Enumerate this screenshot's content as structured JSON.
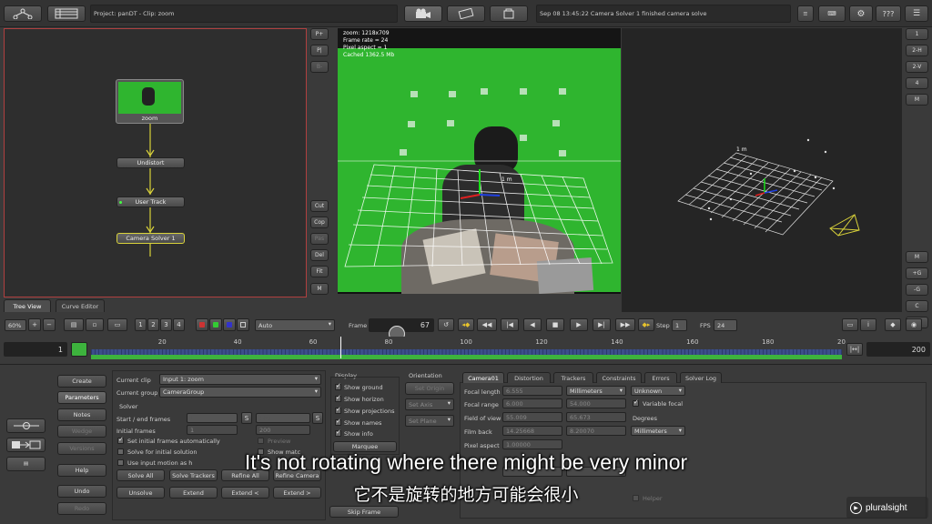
{
  "toolbar": {
    "project_info": "Project: panDT - Clip: zoom",
    "status_message": "Sep 08 13:45:22 Camera Solver 1 finished camera solve",
    "help_label": "???"
  },
  "node_graph": {
    "nodes": [
      "zoom",
      "Undistort",
      "User Track",
      "Camera Solver 1"
    ],
    "side_buttons": [
      "P+",
      "P|",
      "B-",
      "Cut",
      "Cop",
      "Pas",
      "Del",
      "Fit",
      "M"
    ],
    "tabs": [
      "Tree View",
      "Curve Editor"
    ],
    "zoom": "60%",
    "num_buttons": [
      "1",
      "2",
      "3",
      "4"
    ]
  },
  "viewer": {
    "info_lines": [
      "zoom: 1218x709",
      "Frame rate = 24",
      "Pixel aspect = 1",
      "Cached 1362.5 Mb"
    ],
    "grid_label": "1 m",
    "display_mode": "Auto"
  },
  "view3d": {
    "grid_label": "1 m",
    "right_buttons": [
      "1",
      "2-H",
      "2-V",
      "4",
      "M",
      "+G",
      "-G",
      "C",
      "D"
    ]
  },
  "playback": {
    "frame_label": "Frame",
    "frame_value": "67",
    "step_label": "Step",
    "step_value": "1",
    "fps_label": "FPS",
    "fps_value": "24"
  },
  "timeline": {
    "start": "1",
    "end": "200",
    "ticks": [
      "20",
      "40",
      "60",
      "80",
      "100",
      "120",
      "140",
      "160",
      "180",
      "20"
    ],
    "current_frame": 67
  },
  "left_buttons": [
    "Create",
    "Parameters",
    "Notes",
    "Wedge",
    "Versions",
    "Help",
    "Undo",
    "Redo"
  ],
  "solver": {
    "current_clip_label": "Current clip",
    "current_clip_value": "Input 1: zoom",
    "current_group_label": "Current group",
    "current_group_value": "CameraGroup",
    "section_title": "Solver",
    "start_end_label": "Start / end frames",
    "start_value": "1",
    "end_value": "200",
    "s_label": "S",
    "initial_frames_label": "Initial frames",
    "initial_start": "1",
    "initial_end": "200",
    "set_initial_auto": "Set initial frames automatically",
    "solve_initial": "Solve for initial solution",
    "use_input_motion": "Use input motion as h",
    "preview": "Preview",
    "show_matches": "Show matc",
    "buttons_row1": [
      "Solve All",
      "Solve Trackers",
      "Refine All",
      "Refine Camera"
    ],
    "buttons_row2": [
      "Unsolve",
      "Extend",
      "Extend <",
      "Extend >"
    ]
  },
  "display": {
    "title": "Display",
    "options": [
      "Show ground",
      "Show horizon",
      "Show projections",
      "Show names",
      "Show info"
    ],
    "marquee": "Marquee",
    "skip_frame": "Skip Frame"
  },
  "orientation": {
    "title": "Orientation",
    "set_origin": "Set Origin",
    "set_axis": "Set Axis",
    "set_plane": "Set Plane"
  },
  "camera": {
    "tabs": [
      "Camera01",
      "Distortion",
      "Trackers",
      "Constraints",
      "Errors",
      "Solver Log"
    ],
    "focal_length_label": "Focal length",
    "focal_length_value": "6.555",
    "focal_units": "Millimeters",
    "focal_mode": "Unknown",
    "focal_range_label": "Focal range",
    "focal_range_min": "6.000",
    "focal_range_max": "54.000",
    "variable_focal": "Variable focal",
    "fov_label": "Field of view",
    "fov_h": "55.009",
    "fov_v": "65.673",
    "degrees": "Degrees",
    "film_back_label": "Film back",
    "film_back_w": "14.25668",
    "film_back_h": "8.20070",
    "film_units": "Millimeters",
    "pixel_aspect_label": "Pixel aspect",
    "pixel_aspect_value": "1.00000",
    "helper": "Helper"
  },
  "subtitles": {
    "english": "It's not rotating where there might be very minor",
    "chinese": "它不是旋转的地方可能会很小"
  },
  "watermark": "pluralsight",
  "colors": {
    "green_screen": "#2fb52f",
    "node_wire": "#d9d23a",
    "timeline_green": "#3db33d",
    "timeline_blue": "#3c4f8a"
  }
}
